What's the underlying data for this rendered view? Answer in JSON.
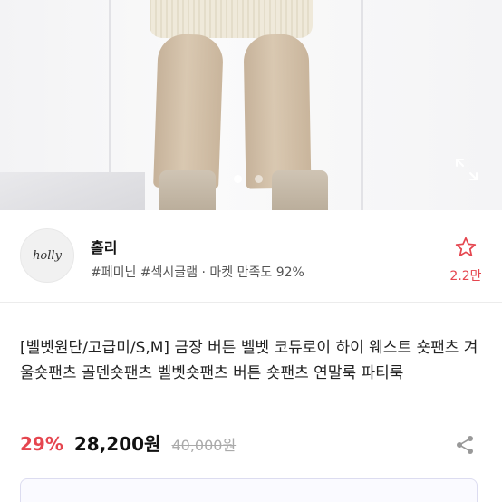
{
  "gallery": {
    "dots": [
      true,
      false
    ],
    "expand_icon": "expand-icon"
  },
  "seller": {
    "avatar_text": "holly",
    "name": "홀리",
    "tags": "#페미닌 #섹시글램 · 마켓 만족도 92%",
    "favorite_count": "2.2만",
    "favorite_icon": "star-icon"
  },
  "product": {
    "title": "[벨벳원단/고급미/S,M] 금장 버튼 벨벳 코듀로이 하이 웨스트 숏팬츠 겨울숏팬츠 골덴숏팬츠 벨벳숏팬츠 버튼 숏팬츠 연말룩 파티룩",
    "discount": "29%",
    "price": "28,200원",
    "original_price": "40,000원",
    "share_icon": "share-icon"
  },
  "colors": {
    "accent": "#e5464f"
  }
}
